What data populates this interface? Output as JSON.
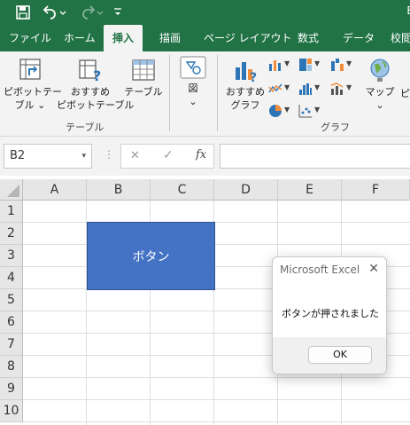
{
  "title_bar": {
    "app_initial": "E"
  },
  "tabs": [
    {
      "label": "ファイル"
    },
    {
      "label": "ホーム"
    },
    {
      "label": "挿入",
      "active": true
    },
    {
      "label": "描画"
    },
    {
      "label": "ページ レイアウト"
    },
    {
      "label": "数式"
    },
    {
      "label": "データ"
    },
    {
      "label": "校閲"
    }
  ],
  "ribbon": {
    "pivot_table_line1": "ピボットテー",
    "pivot_table_line2": "ブル ⌄",
    "recommended_pivot_line1": "おすすめ",
    "recommended_pivot_line2": "ピボットテーブル",
    "table_label": "テーブル",
    "group_table": "テーブル",
    "illustrations_label": "図",
    "illustrations_dropdown": "⌄",
    "recommended_charts_line1": "おすすめ",
    "recommended_charts_line2": "グラフ",
    "group_charts": "グラフ",
    "maps_label": "マップ",
    "maps_dropdown": "⌄",
    "pivot_chart_partial": "ピ",
    "colors": {
      "accent": "#217346",
      "chart_blue": "#2e75b6",
      "chart_orange": "#f08d3c"
    }
  },
  "formula_bar": {
    "name_box": "B2",
    "name_box_arrow": "▾",
    "cancel_symbol": "✕",
    "enter_symbol": "✓",
    "fx_symbol": "fx",
    "formula_value": ""
  },
  "grid": {
    "columns": [
      "A",
      "B",
      "C",
      "D",
      "E",
      "F"
    ],
    "rows": [
      "1",
      "2",
      "3",
      "4",
      "5",
      "6",
      "7",
      "8",
      "9",
      "10"
    ]
  },
  "shape_button": {
    "label": "ボタン",
    "fill": "#4472c4"
  },
  "dialog": {
    "title": "Microsoft Excel",
    "close_symbol": "✕",
    "message": "ボタンが押されました",
    "ok_label": "OK"
  }
}
